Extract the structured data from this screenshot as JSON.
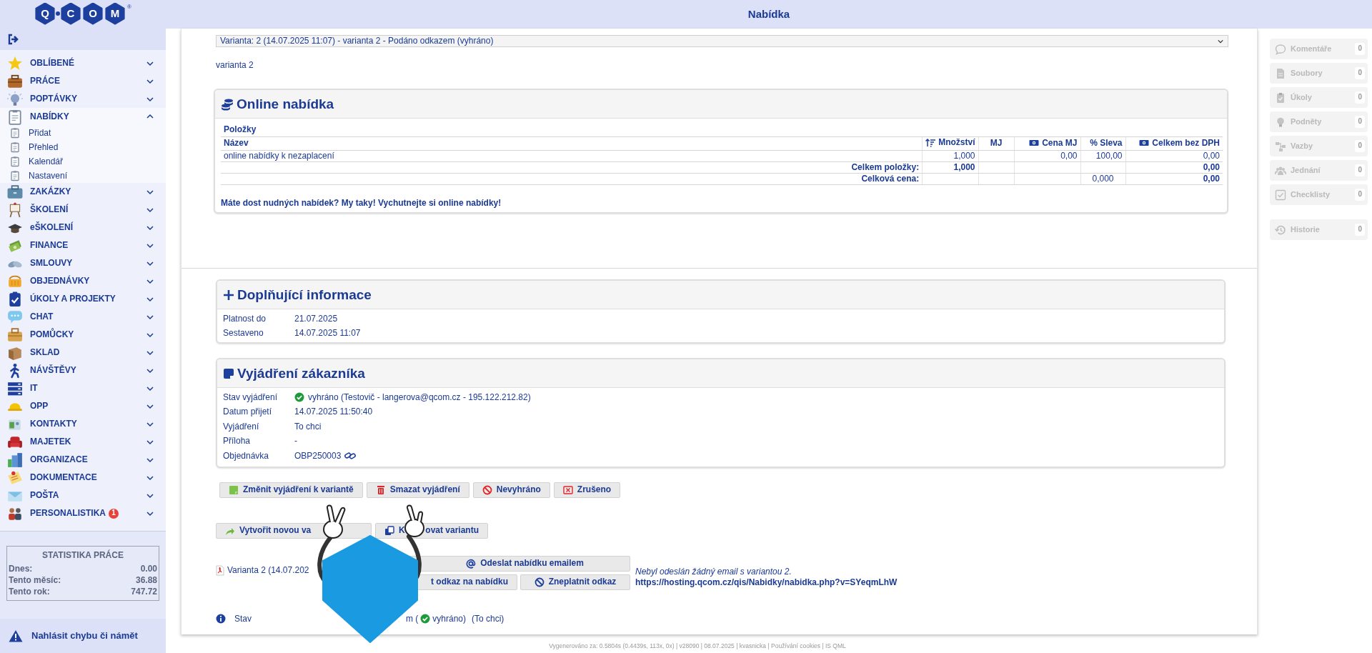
{
  "header": {
    "title": "Nabídka"
  },
  "logo": {
    "letters": [
      "Q",
      "C",
      "O",
      "M"
    ],
    "mark": "®"
  },
  "sidebar": {
    "items": [
      {
        "label": "OBLÍBENÉ",
        "expanded": false
      },
      {
        "label": "PRÁCE",
        "expanded": false
      },
      {
        "label": "POPTÁVKY",
        "expanded": false
      },
      {
        "label": "NABÍDKY",
        "expanded": true,
        "children": [
          {
            "label": "Přidat"
          },
          {
            "label": "Přehled"
          },
          {
            "label": "Kalendář"
          },
          {
            "label": "Nastavení"
          }
        ]
      },
      {
        "label": "ZAKÁZKY",
        "expanded": false
      },
      {
        "label": "ŠKOLENÍ",
        "expanded": false
      },
      {
        "label": "eŠKOLENÍ",
        "expanded": false
      },
      {
        "label": "FINANCE",
        "expanded": false
      },
      {
        "label": "SMLOUVY",
        "expanded": false
      },
      {
        "label": "OBJEDNÁVKY",
        "expanded": false
      },
      {
        "label": "ÚKOLY A PROJEKTY",
        "expanded": false
      },
      {
        "label": "CHAT",
        "expanded": false
      },
      {
        "label": "POMŮCKY",
        "expanded": false
      },
      {
        "label": "SKLAD",
        "expanded": false
      },
      {
        "label": "NÁVŠTĚVY",
        "expanded": false
      },
      {
        "label": "IT",
        "expanded": false
      },
      {
        "label": "OPP",
        "expanded": false
      },
      {
        "label": "KONTAKTY",
        "expanded": false
      },
      {
        "label": "MAJETEK",
        "expanded": false
      },
      {
        "label": "ORGANIZACE",
        "expanded": false
      },
      {
        "label": "DOKUMENTACE",
        "expanded": false
      },
      {
        "label": "POŠTA",
        "expanded": false
      },
      {
        "label": "PERSONALISTIKA",
        "expanded": false,
        "badge": "1"
      }
    ],
    "stats": {
      "title": "STATISTIKA PRÁCE",
      "rows": [
        {
          "label": "Dnes:",
          "value": "0.00"
        },
        {
          "label": "Tento měsíc:",
          "value": "36.88"
        },
        {
          "label": "Tento rok:",
          "value": "747.72"
        }
      ]
    },
    "report": "Nahlásit chybu či námět"
  },
  "offer": {
    "variant_select": "Varianta: 2 (14.07.2025 11:07) - varianta 2 - Podáno odkazem (vyhráno)",
    "variant_name": "varianta 2",
    "online": {
      "title": "Online nabídka",
      "section": "Položky",
      "columns": [
        {
          "label": "Název",
          "kind": "text"
        },
        {
          "label": "Množství",
          "kind": "sort"
        },
        {
          "label": "MJ",
          "kind": "plain"
        },
        {
          "label": "Cena MJ",
          "kind": "price"
        },
        {
          "label": "% Sleva",
          "kind": "plain"
        },
        {
          "label": "Celkem bez DPH",
          "kind": "price"
        }
      ],
      "rows": [
        [
          "online nabídky k nezaplacení",
          "1,000",
          null,
          "0,00",
          "100,00",
          "0,00"
        ]
      ],
      "totals": [
        {
          "label": "Celkem položky:",
          "cells": [
            {
              "text": "1,000",
              "bold": true
            },
            null,
            null,
            null,
            {
              "text": "0,00",
              "bold": true
            }
          ]
        },
        {
          "label": "Celková cena:",
          "cells": [
            null,
            null,
            null,
            {
              "text": "0,000",
              "bold": false
            },
            {
              "text": "0,00",
              "bold": true
            }
          ]
        }
      ],
      "promo": "Máte dost nudných nabídek? My taky! Vychutnejte si online nabídky!"
    },
    "additional": {
      "title": "Doplňující informace",
      "rows": [
        {
          "label": "Platnost do",
          "value": "21.07.2025"
        },
        {
          "label": "Sestaveno",
          "value": "14.07.2025 11:07"
        }
      ]
    },
    "response": {
      "title": "Vyjádření zákazníka",
      "rows": [
        {
          "label": "Stav vyjádření",
          "value": "vyhráno (Testovič - langerova@qcom.cz - 195.122.212.82)",
          "kind": "status"
        },
        {
          "label": "Datum přijetí",
          "value": "14.07.2025 11:50:40",
          "kind": "text"
        },
        {
          "label": "Vyjádření",
          "value": "To chci",
          "kind": "text"
        },
        {
          "label": "Příloha",
          "value": "-",
          "kind": "text"
        },
        {
          "label": "Objednávka",
          "value": "OBP250003",
          "kind": "link"
        }
      ]
    },
    "response_buttons": [
      {
        "label": "Změnit vyjádření k variantě",
        "kind": "edit"
      },
      {
        "label": "Smazat vyjádření",
        "kind": "delete"
      },
      {
        "label": "Nevyhráno",
        "kind": "lost"
      },
      {
        "label": "Zrušeno",
        "kind": "cancel"
      }
    ],
    "variant_buttons": [
      {
        "parts": [
          "Vytvořit novou va"
        ],
        "kind": "new"
      },
      {
        "parts": [
          "K",
          "ovat variantu"
        ],
        "kind": "copy"
      }
    ],
    "document": {
      "link": "Varianta 2 (14.07.202",
      "email_button": "Odeslat nabídku emailem",
      "link_buttons": [
        {
          "label": "t odkaz na nabídku",
          "kind": "plain"
        },
        {
          "label": "Zneplatnit odkaz",
          "kind": "invalidate"
        }
      ],
      "note": "Nebyl odeslán žádný email s variantou 2.",
      "url": "https://hosting.qcom.cz/qis/Nabidky/nabidka.php?v=SYeqmLhW"
    },
    "status": {
      "label": "Stav",
      "prefix": "m (",
      "value": "vyhráno)",
      "extra": "(To chci)"
    }
  },
  "side_panel": {
    "groups": [
      [
        {
          "label": "Komentáře",
          "count": "0",
          "disabled": true
        },
        {
          "label": "Soubory",
          "count": "0",
          "disabled": true
        },
        {
          "label": "Úkoly",
          "count": "0",
          "disabled": true
        },
        {
          "label": "Podněty",
          "count": "0",
          "disabled": true
        },
        {
          "label": "Vazby",
          "count": "0",
          "disabled": true
        },
        {
          "label": "Jednání",
          "count": "0",
          "disabled": true
        },
        {
          "label": "Checklisty",
          "count": "0",
          "disabled": true
        }
      ],
      [
        {
          "label": "Historie",
          "count": "0",
          "disabled": true
        }
      ]
    ]
  },
  "footer": "Vygenerováno za: 0.5804s (0.4439s, 113x, 0x) | v28090 | 08.07.2025 | kvasnicka | Používání cookies | IS QML"
}
